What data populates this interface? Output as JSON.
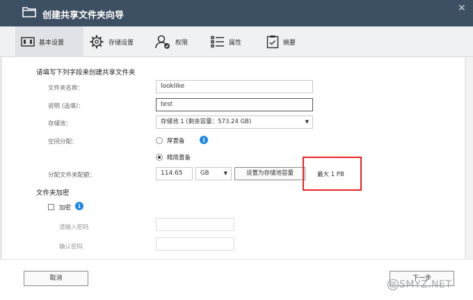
{
  "window": {
    "title": "创建共享文件夹向导",
    "close_symbol": "✕"
  },
  "tabs": [
    {
      "label": "基本设置",
      "icon": "basic-settings-icon",
      "active": true
    },
    {
      "label": "存储设置",
      "icon": "gear-icon",
      "active": false
    },
    {
      "label": "权限",
      "icon": "user-permission-icon",
      "active": false
    },
    {
      "label": "属性",
      "icon": "list-icon",
      "active": false
    },
    {
      "label": "摘要",
      "icon": "clipboard-icon",
      "active": false
    }
  ],
  "form": {
    "heading": "请填写下列字段来创建共享文件夹",
    "folder_name": {
      "label": "文件夹名称：",
      "value": "looklike"
    },
    "description": {
      "label": "说明 (选填)：",
      "value": "test"
    },
    "storage_pool": {
      "label": "存储池：",
      "value": "存储池 1 (剩余容量：573.24 GB)"
    },
    "space_allocation": {
      "label": "空间分配：",
      "thick": {
        "label": "厚置备",
        "selected": false
      },
      "thin": {
        "label": "精简置备",
        "selected": true
      }
    },
    "quota": {
      "label": "分配文件夹配额：",
      "value": "114.65",
      "unit": "GB",
      "set_button": "设置为存储池容量",
      "max_text": "最大  1 PB"
    }
  },
  "encryption": {
    "heading": "文件夹加密",
    "checkbox_label": "加密",
    "checked": false,
    "password_label": "请输入密码",
    "confirm_label": "确认密码"
  },
  "footer": {
    "cancel_label": "取消",
    "next_label": "下一步"
  },
  "watermark": {
    "text": "SMYZ.NET"
  },
  "colors": {
    "titlebar": "#3d4f62",
    "highlight": "#e8201e",
    "info": "#1e88e5"
  }
}
